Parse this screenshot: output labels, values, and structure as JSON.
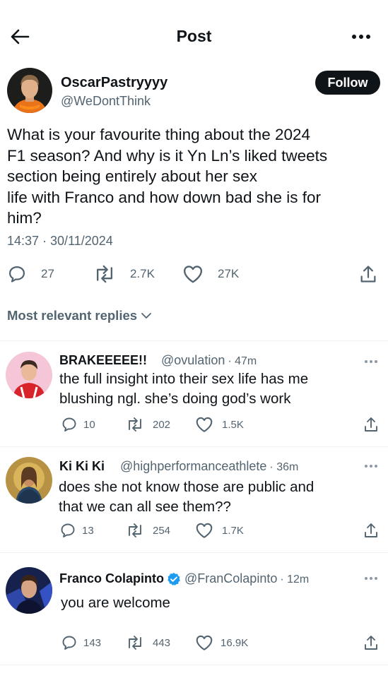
{
  "header": {
    "title": "Post",
    "back_icon": "arrow-left-icon",
    "more_icon": "more-horizontal-icon"
  },
  "post": {
    "author_name": "OscarPastryyyy",
    "author_handle": "@WeDontThink",
    "follow_label": "Follow",
    "text_lines": [
      "What is your favourite thing about the 2024",
      "F1 season? And why is it Yn Ln’s liked tweets",
      "section being entirely about her sex",
      "life with Franco and how down bad she is for",
      "him?"
    ],
    "timestamp": "14:37 · 30/11/2024",
    "replies": "27",
    "reposts": "2.7K",
    "likes": "27K"
  },
  "sort": {
    "label": "Most relevant replies"
  },
  "replies": [
    {
      "name": "BRAKEEEEE!!",
      "handle": "@ovulation",
      "time": "· 47m",
      "text_lines": [
        "the full insight into their sex life has me",
        "blushing ngl. she’s doing god’s work"
      ],
      "replies": "10",
      "reposts": "202",
      "likes": "1.5K"
    },
    {
      "name": "Ki Ki Ki",
      "handle": "@highperformanceathlete",
      "time": "· 36m",
      "text_lines": [
        "does she not know those are public and",
        "that we can all see them??"
      ],
      "replies": "13",
      "reposts": "254",
      "likes": "1.7K"
    },
    {
      "name": "Franco Colapinto",
      "handle": "@FranColapinto",
      "time": "· 12m",
      "verified": true,
      "text_lines": [
        "you are welcome"
      ],
      "replies": "143",
      "reposts": "443",
      "likes": "16.9K"
    }
  ],
  "colors": {
    "text": "#0f1419",
    "muted": "#536471",
    "verified": "#1d9bf0",
    "divider": "#eff3f4"
  }
}
